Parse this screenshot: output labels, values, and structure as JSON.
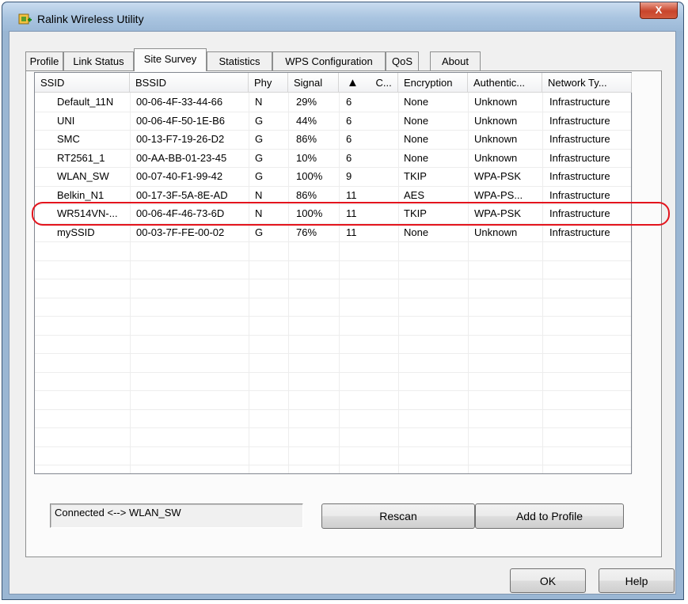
{
  "window": {
    "title": "Ralink Wireless Utility",
    "close_glyph": "X"
  },
  "tabs": [
    {
      "label": "Profile"
    },
    {
      "label": "Link Status"
    },
    {
      "label": "Site Survey"
    },
    {
      "label": "Statistics"
    },
    {
      "label": "WPS Configuration"
    },
    {
      "label": "QoS"
    },
    {
      "label": "About"
    }
  ],
  "active_tab": "Site Survey",
  "table": {
    "columns": [
      "SSID",
      "BSSID",
      "Phy",
      "Signal",
      "C...",
      "Encryption",
      "Authentic...",
      "Network Ty..."
    ],
    "sort_indicator": "▲",
    "rows": [
      [
        "Default_11N",
        "00-06-4F-33-44-66",
        "N",
        "29%",
        "6",
        "None",
        "Unknown",
        "Infrastructure"
      ],
      [
        "UNI",
        "00-06-4F-50-1E-B6",
        "G",
        "44%",
        "6",
        "None",
        "Unknown",
        "Infrastructure"
      ],
      [
        "SMC",
        "00-13-F7-19-26-D2",
        "G",
        "86%",
        "6",
        "None",
        "Unknown",
        "Infrastructure"
      ],
      [
        "RT2561_1",
        "00-AA-BB-01-23-45",
        "G",
        "10%",
        "6",
        "None",
        "Unknown",
        "Infrastructure"
      ],
      [
        "WLAN_SW",
        "00-07-40-F1-99-42",
        "G",
        "100%",
        "9",
        "TKIP",
        "WPA-PSK",
        "Infrastructure"
      ],
      [
        "Belkin_N1",
        "00-17-3F-5A-8E-AD",
        "N",
        "86%",
        "11",
        "AES",
        "WPA-PS...",
        "Infrastructure"
      ],
      [
        "WR514VN-...",
        "00-06-4F-46-73-6D",
        "N",
        "100%",
        "11",
        "TKIP",
        "WPA-PSK",
        "Infrastructure"
      ],
      [
        "mySSID",
        "00-03-7F-FE-00-02",
        "G",
        "76%",
        "11",
        "None",
        "Unknown",
        "Infrastructure"
      ]
    ],
    "highlighted_row": "WLAN_SW"
  },
  "status_text": "Connected <--> WLAN_SW",
  "buttons": {
    "rescan": "Rescan",
    "add_to_profile": "Add to Profile",
    "ok": "OK",
    "help": "Help"
  },
  "colors": {
    "highlight": "#e3141d",
    "titlebar": "#a9c4e0",
    "close": "#c8452c"
  }
}
